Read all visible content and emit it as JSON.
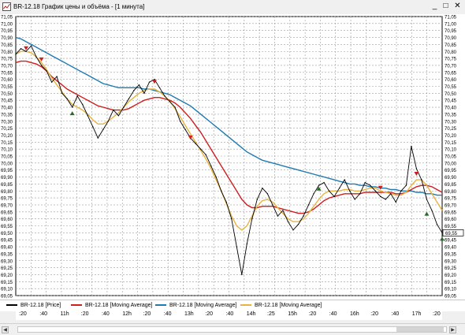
{
  "window": {
    "title": "BR-12.18 График цены и объёма - [1 минута]",
    "buttons": {
      "minimize": "_",
      "maximize": "□",
      "close": "✕"
    }
  },
  "legend": [
    {
      "label": "BR-12.18 [Price]",
      "color": "#000000"
    },
    {
      "label": "BR-12.18 [Moving Average]",
      "color": "#cc2020"
    },
    {
      "label": "BR-12.18 [Moving Average]",
      "color": "#1f7ab0"
    },
    {
      "label": "BR-12.18 [Moving Average]",
      "color": "#e8b440"
    }
  ],
  "time_axis_labels": [
    ":20",
    ":40",
    "11h",
    ":20",
    ":40",
    "12h",
    ":20",
    ":40",
    "13h",
    ":20",
    ":40",
    "14h",
    ":25",
    "15h",
    ":20",
    ":40",
    "16h",
    ":20",
    ":40",
    "17h",
    ":20"
  ],
  "current_price_label": "69,55",
  "chart_data": {
    "type": "line",
    "title": "BR-12.18 График цены и объёма - [1 минута]",
    "xlabel": "",
    "ylabel": "",
    "ylim": [
      69.05,
      71.05
    ],
    "y_ticks": [
      "71,05",
      "71,00",
      "70,95",
      "70,90",
      "70,85",
      "70,80",
      "70,75",
      "70,70",
      "70,65",
      "70,60",
      "70,55",
      "70,50",
      "70,45",
      "70,40",
      "70,35",
      "70,30",
      "70,25",
      "70,20",
      "70,15",
      "70,10",
      "70,05",
      "70,00",
      "69,95",
      "69,90",
      "69,85",
      "69,80",
      "69,75",
      "69,70",
      "69,65",
      "69,60",
      "69,55",
      "69,50",
      "69,45",
      "69,40",
      "69,35",
      "69,30",
      "69,25",
      "69,20",
      "69,15",
      "69,10",
      "69,05"
    ],
    "x_categories": [
      ":20",
      ":40",
      "11h",
      ":20",
      ":40",
      "12h",
      ":20",
      ":40",
      "13h",
      ":20",
      ":40",
      "14h",
      ":25",
      "15h",
      ":20",
      ":40",
      "16h",
      ":20",
      ":40",
      "17h",
      ":20"
    ],
    "grid": true,
    "legend_placement": "bottom",
    "series": [
      {
        "name": "BR-12.18 [Price]",
        "color": "#000000",
        "values": [
          70.78,
          70.82,
          70.8,
          70.84,
          70.76,
          70.7,
          70.66,
          70.58,
          70.62,
          70.5,
          70.46,
          70.4,
          70.48,
          70.42,
          70.34,
          70.26,
          70.18,
          70.24,
          70.3,
          70.38,
          70.34,
          70.4,
          70.46,
          70.52,
          70.56,
          70.5,
          70.58,
          70.6,
          70.54,
          70.48,
          70.44,
          70.4,
          70.3,
          70.24,
          70.18,
          70.14,
          70.1,
          70.06,
          69.98,
          69.9,
          69.8,
          69.72,
          69.6,
          69.4,
          69.2,
          69.42,
          69.6,
          69.74,
          69.82,
          69.78,
          69.7,
          69.62,
          69.66,
          69.58,
          69.52,
          69.56,
          69.62,
          69.7,
          69.78,
          69.84,
          69.86,
          69.8,
          69.76,
          69.82,
          69.88,
          69.8,
          69.74,
          69.78,
          69.86,
          69.84,
          69.8,
          69.76,
          69.74,
          69.78,
          69.72,
          69.8,
          69.84,
          70.12,
          69.96,
          69.88,
          69.74,
          69.66,
          69.56,
          69.5
        ]
      },
      {
        "name": "BR-12.18 [Moving Average]",
        "color": "#cc2020",
        "values": [
          70.72,
          70.73,
          70.73,
          70.72,
          70.71,
          70.69,
          70.66,
          70.62,
          70.59,
          70.56,
          70.53,
          70.51,
          70.49,
          70.47,
          70.45,
          70.43,
          70.41,
          70.4,
          70.39,
          70.38,
          70.38,
          70.38,
          70.39,
          70.41,
          70.43,
          70.45,
          70.46,
          70.47,
          70.47,
          70.46,
          70.45,
          70.43,
          70.4,
          70.36,
          70.32,
          70.27,
          70.22,
          70.16,
          70.1,
          70.04,
          69.98,
          69.92,
          69.86,
          69.8,
          69.74,
          69.7,
          69.68,
          69.68,
          69.69,
          69.69,
          69.69,
          69.68,
          69.67,
          69.66,
          69.65,
          69.64,
          69.64,
          69.65,
          69.67,
          69.7,
          69.73,
          69.75,
          69.76,
          69.77,
          69.78,
          69.78,
          69.78,
          69.78,
          69.79,
          69.79,
          69.79,
          69.79,
          69.79,
          69.79,
          69.78,
          69.78,
          69.79,
          69.81,
          69.83,
          69.84,
          69.84,
          69.83,
          69.81,
          69.79
        ]
      },
      {
        "name": "BR-12.18 [Moving Average]",
        "color": "#1f7ab0",
        "values": [
          70.9,
          70.89,
          70.87,
          70.85,
          70.83,
          70.81,
          70.79,
          70.77,
          70.75,
          70.73,
          70.71,
          70.69,
          70.67,
          70.65,
          70.63,
          70.61,
          70.59,
          70.57,
          70.56,
          70.55,
          70.54,
          70.54,
          70.54,
          70.54,
          70.54,
          70.53,
          70.53,
          70.52,
          70.51,
          70.5,
          70.49,
          70.47,
          70.45,
          70.43,
          70.41,
          70.38,
          70.35,
          70.32,
          70.29,
          70.26,
          70.23,
          70.2,
          70.17,
          70.14,
          70.11,
          70.08,
          70.06,
          70.04,
          70.02,
          70.01,
          70.0,
          69.99,
          69.98,
          69.97,
          69.96,
          69.95,
          69.94,
          69.93,
          69.92,
          69.91,
          69.9,
          69.89,
          69.88,
          69.87,
          69.86,
          69.85,
          69.85,
          69.84,
          69.84,
          69.83,
          69.83,
          69.82,
          69.82,
          69.81,
          69.81,
          69.8,
          69.8,
          69.8,
          69.79,
          69.79,
          69.78,
          69.78,
          69.77,
          69.77
        ]
      },
      {
        "name": "BR-12.18 [Moving Average]",
        "color": "#e8b440",
        "values": [
          70.78,
          70.8,
          70.8,
          70.79,
          70.76,
          70.72,
          70.67,
          70.61,
          70.56,
          70.51,
          70.46,
          70.42,
          70.4,
          70.38,
          70.35,
          70.31,
          70.28,
          70.28,
          70.3,
          70.33,
          70.36,
          70.4,
          70.44,
          70.47,
          70.5,
          70.52,
          70.53,
          70.53,
          70.51,
          70.48,
          70.44,
          70.39,
          70.33,
          70.27,
          70.21,
          70.15,
          70.09,
          70.03,
          69.96,
          69.88,
          69.8,
          69.71,
          69.62,
          69.55,
          69.52,
          69.55,
          69.62,
          69.69,
          69.73,
          69.74,
          69.72,
          69.68,
          69.64,
          69.6,
          69.58,
          69.58,
          69.6,
          69.64,
          69.69,
          69.74,
          69.78,
          69.8,
          69.8,
          69.8,
          69.81,
          69.81,
          69.8,
          69.8,
          69.81,
          69.82,
          69.82,
          69.8,
          69.79,
          69.78,
          69.77,
          69.77,
          69.79,
          69.84,
          69.88,
          69.88,
          69.84,
          69.78,
          69.72,
          69.66
        ]
      }
    ],
    "markers": [
      {
        "type": "down",
        "color": "#cc2020",
        "index": 2,
        "value": 70.82
      },
      {
        "type": "down",
        "color": "#cc2020",
        "index": 5,
        "value": 70.74
      },
      {
        "type": "up",
        "color": "#2a6a2a",
        "index": 11,
        "value": 70.36
      },
      {
        "type": "down",
        "color": "#cc2020",
        "index": 27,
        "value": 70.58
      },
      {
        "type": "down",
        "color": "#cc2020",
        "index": 34,
        "value": 70.18
      },
      {
        "type": "up",
        "color": "#2a6a2a",
        "index": 59,
        "value": 69.82
      },
      {
        "type": "down",
        "color": "#cc2020",
        "index": 71,
        "value": 69.82
      },
      {
        "type": "down",
        "color": "#cc2020",
        "index": 78,
        "value": 69.92
      },
      {
        "type": "up",
        "color": "#2a6a2a",
        "index": 80,
        "value": 69.64
      },
      {
        "type": "up",
        "color": "#2a6a2a",
        "index": 83,
        "value": 69.46
      }
    ]
  }
}
